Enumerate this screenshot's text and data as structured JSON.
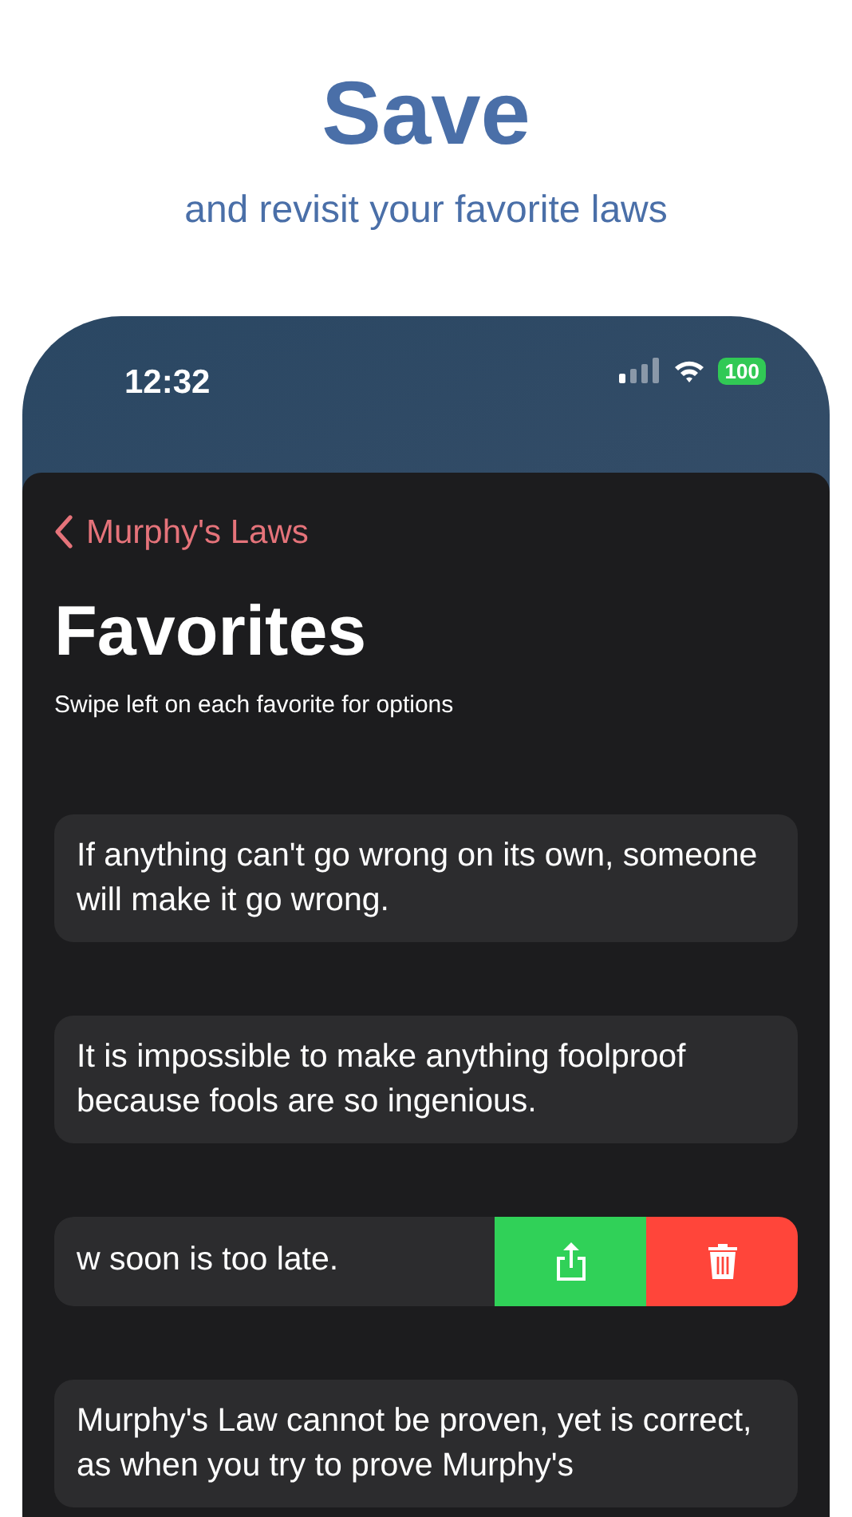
{
  "header": {
    "title": "Save",
    "subtitle": "and revisit your favorite laws"
  },
  "status_bar": {
    "time": "12:32",
    "battery": "100"
  },
  "nav": {
    "back_label": "Murphy's Laws"
  },
  "page": {
    "title": "Favorites",
    "hint": "Swipe left on each favorite for options"
  },
  "favorites": [
    {
      "text": "If anything can't go wrong on its own, someone will make it go wrong.",
      "swiped": false
    },
    {
      "text": "It is impossible to make anything foolproof because fools are so ingenious.",
      "swiped": false
    },
    {
      "text": "w soon is too late.",
      "swiped": true
    },
    {
      "text": "Murphy's Law cannot be proven, yet is correct, as when you try to prove Murphy's",
      "swiped": false
    }
  ]
}
